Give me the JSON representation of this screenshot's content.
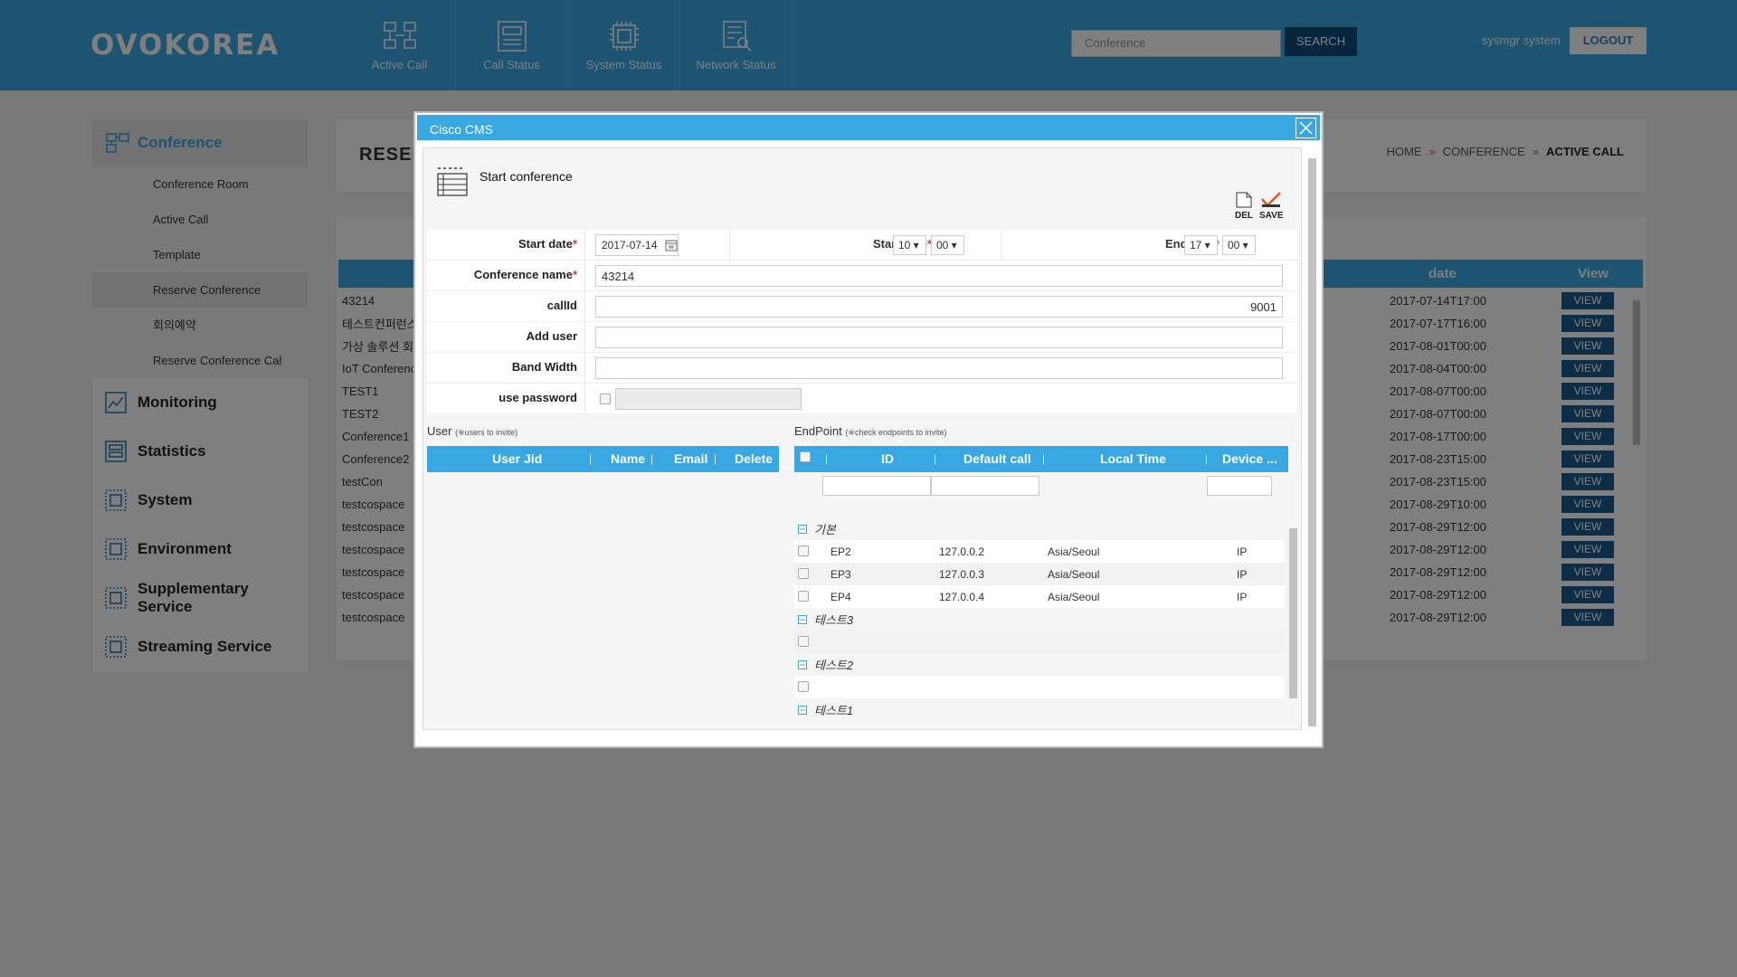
{
  "header": {
    "logo": "OVOKOREA",
    "nav": [
      {
        "label": "Active Call",
        "icon": "network-nodes-icon"
      },
      {
        "label": "Call Status",
        "icon": "server-panel-icon"
      },
      {
        "label": "System Status",
        "icon": "cpu-chip-icon"
      },
      {
        "label": "Network Status",
        "icon": "network-search-icon"
      }
    ],
    "search_placeholder": "Conference",
    "search_label": "SEARCH",
    "user": "sysmgr system",
    "logout_label": "LOGOUT"
  },
  "sidebar": {
    "active_section": "Conference",
    "sub_items": [
      "Conference Room",
      "Active Call",
      "Template",
      "Reserve Conference",
      "회의예약",
      "Reserve Conference Cal"
    ],
    "categories": [
      "Monitoring",
      "Statistics",
      "System",
      "Environment",
      "Supplementary Service",
      "Streaming Service"
    ]
  },
  "page": {
    "title": "RESERV",
    "breadcrumb": [
      "HOME",
      "CONFERENCE",
      "ACTIVE CALL"
    ]
  },
  "table": {
    "headers": {
      "date": "date",
      "view": "View"
    },
    "view_label": "VIEW",
    "rows": [
      {
        "name": "43214",
        "date": "2017-07-14T17:00"
      },
      {
        "name": "테스트컨퍼런스",
        "date": "2017-07-17T16:00"
      },
      {
        "name": "가상 솔루션 회",
        "date": "2017-08-01T00:00"
      },
      {
        "name": "IoT Conference",
        "date": "2017-08-04T00:00"
      },
      {
        "name": "TEST1",
        "date": "2017-08-07T00:00"
      },
      {
        "name": "TEST2",
        "date": "2017-08-07T00:00"
      },
      {
        "name": "Conference1",
        "date": "2017-08-17T00:00"
      },
      {
        "name": "Conference2",
        "date": "2017-08-23T15:00"
      },
      {
        "name": "testCon",
        "date": "2017-08-23T15:00"
      },
      {
        "name": "testcospace",
        "date": "2017-08-29T10:00"
      },
      {
        "name": "testcospace",
        "date": "2017-08-29T12:00"
      },
      {
        "name": "testcospace",
        "date": "2017-08-29T12:00"
      },
      {
        "name": "testcospace",
        "date": "2017-08-29T12:00"
      },
      {
        "name": "testcospace",
        "date": "2017-08-29T12:00"
      },
      {
        "name": "testcospace",
        "date": "2017-08-29T12:00"
      }
    ]
  },
  "modal": {
    "title": "Cisco CMS",
    "section_title": "Start conference",
    "del_label": "DEL",
    "save_label": "SAVE",
    "labels": {
      "start_date": "Start date",
      "start_time": "Start time",
      "end_time": "End time",
      "conference_name": "Conference name",
      "callid": "callId",
      "add_user": "Add user",
      "band_width": "Band Width",
      "use_password": "use password",
      "required_mark": "*"
    },
    "values": {
      "start_date": "2017-07-14",
      "start_hour": "10 ▾",
      "start_min": "00 ▾",
      "end_hour": "17 ▾",
      "end_min": "00 ▾",
      "conference_name": "43214",
      "callid": "9001",
      "add_user": "",
      "band_width": ""
    },
    "user_section": {
      "title": "User",
      "hint": "(※users to invite)"
    },
    "user_grid": [
      "User Jid",
      "Name",
      "Email",
      "Delete"
    ],
    "endpoint_section": {
      "title": "EndPoint",
      "hint": "(※check endpoints to invite)"
    },
    "endpoint_grid": [
      "ID",
      "Default call",
      "Local Time",
      "Device ..."
    ],
    "groups": [
      {
        "name": "기본",
        "items": [
          {
            "id": "EP2",
            "call": "127.0.0.2",
            "tz": "Asia/Seoul",
            "dev": "IP"
          },
          {
            "id": "EP3",
            "call": "127.0.0.3",
            "tz": "Asia/Seoul",
            "dev": "IP"
          },
          {
            "id": "EP4",
            "call": "127.0.0.4",
            "tz": "Asia/Seoul",
            "dev": "IP"
          }
        ]
      },
      {
        "name": "테스트3",
        "items": [
          {
            "id": "",
            "call": "",
            "tz": "",
            "dev": ""
          }
        ]
      },
      {
        "name": "테스트2",
        "items": [
          {
            "id": "",
            "call": "",
            "tz": "",
            "dev": ""
          }
        ]
      },
      {
        "name": "테스트1",
        "items": []
      }
    ]
  },
  "colors": {
    "accent": "#39a8e2",
    "dark_button": "#104a7c",
    "view_button": "#1a5b8f",
    "breadcrumb_sep": "#e2592b"
  }
}
